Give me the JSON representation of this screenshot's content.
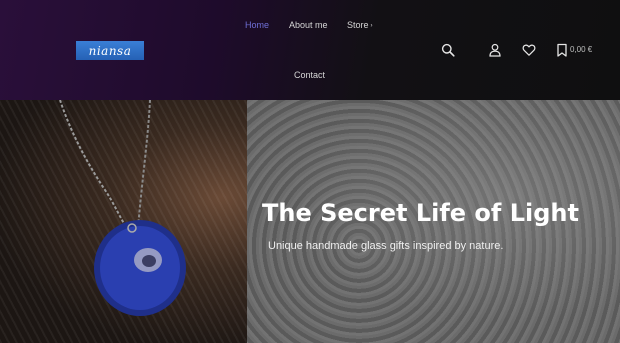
{
  "header": {
    "logo_text": "niansa",
    "nav": {
      "home": "Home",
      "about": "About me",
      "store": "Store",
      "store_caret": "›",
      "contact": "Contact"
    },
    "icons": {
      "search": "search-icon",
      "account": "user-icon",
      "wishlist": "heart-icon",
      "cart": "bag-icon"
    },
    "cart_total": "0,00 €"
  },
  "hero": {
    "title": "The Secret Life of Light",
    "subtitle": "Unique handmade glass gifts inspired by nature."
  },
  "colors": {
    "accent": "#6f6fd6",
    "logo_bg": "#2f6fc8",
    "header_bg": "#1e0b2b"
  }
}
